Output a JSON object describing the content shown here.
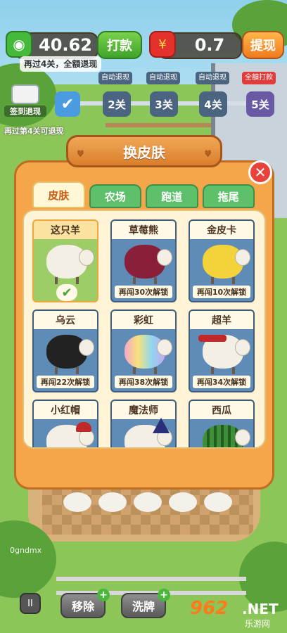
{
  "hud": {
    "cash_value": "40.62",
    "cash_button": "打款",
    "redpack_value": "0.7",
    "redpack_button": "提现",
    "pass_tip": "再过4关，全額退现"
  },
  "levels": {
    "signin_label": "签到退现",
    "signin_tip": "再过第4关可退现",
    "items": [
      {
        "label": "2关",
        "tag": "自动退现"
      },
      {
        "label": "3关",
        "tag": "自动退现"
      },
      {
        "label": "4关",
        "tag": "自动退现"
      },
      {
        "label": "5关",
        "tag": "全額打款"
      }
    ]
  },
  "modal": {
    "title": "换皮肤",
    "close": "✕",
    "tabs": [
      "皮肤",
      "农场",
      "跑道",
      "拖尾"
    ],
    "active_tab": 0,
    "skins": [
      {
        "name": "这只羊",
        "unlock": "",
        "selected": true,
        "color": "#f4efe5"
      },
      {
        "name": "草莓熊",
        "unlock": "再闯30次解锁",
        "color": "#8a1f3a"
      },
      {
        "name": "金皮卡",
        "unlock": "再闯10次解锁",
        "color": "#f3d23a"
      },
      {
        "name": "乌云",
        "unlock": "再闯22次解锁",
        "color": "#222222"
      },
      {
        "name": "彩虹",
        "unlock": "再闯38次解锁",
        "color": "#c9a6f0"
      },
      {
        "name": "超羊",
        "unlock": "再闯34次解锁",
        "color": "#f4efe5"
      },
      {
        "name": "小红帽",
        "unlock": "",
        "color": "#f4efe5"
      },
      {
        "name": "魔法师",
        "unlock": "",
        "color": "#f4efe5"
      },
      {
        "name": "西瓜",
        "unlock": "",
        "color": "#3f8f3a"
      }
    ]
  },
  "bottom": {
    "pause": "II",
    "remove": "移除",
    "shuffle": "洗牌",
    "player_tag": "0gndmx"
  },
  "watermark": {
    "num": "962",
    "net": ".NET",
    "sub": "乐游网"
  }
}
